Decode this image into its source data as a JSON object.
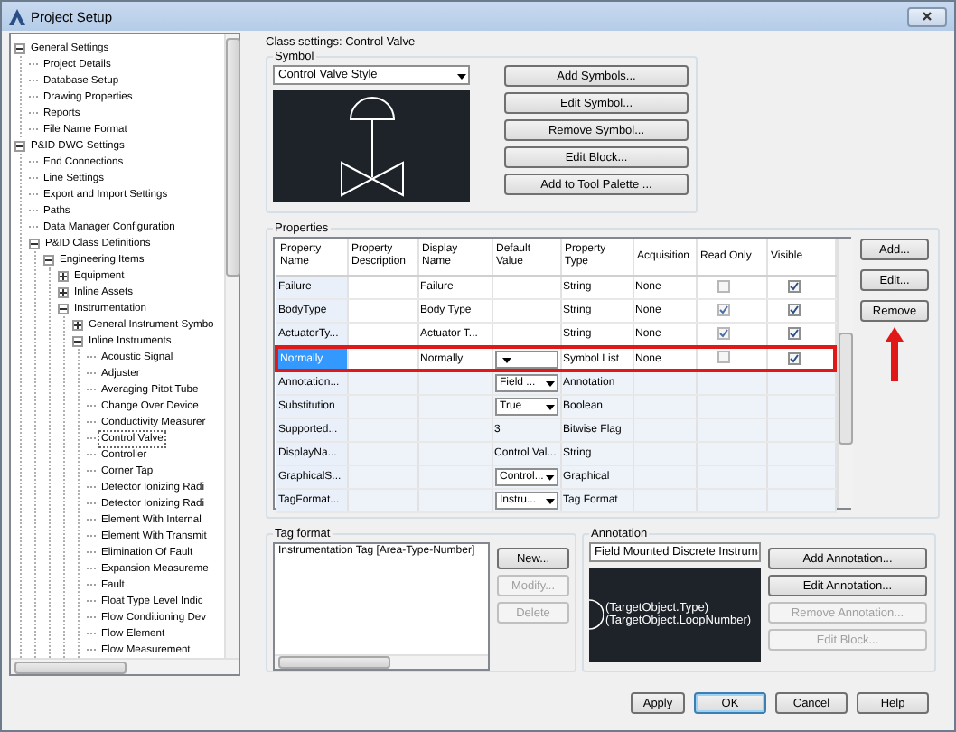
{
  "window": {
    "title": "Project Setup"
  },
  "tree": [
    {
      "label": "General Settings",
      "expanded": true,
      "selected": false,
      "children": [
        {
          "label": "Project Details",
          "selected": false
        },
        {
          "label": "Database Setup",
          "selected": false
        },
        {
          "label": "Drawing Properties",
          "selected": false
        },
        {
          "label": "Reports",
          "selected": false
        },
        {
          "label": "File Name Format",
          "selected": false
        }
      ]
    },
    {
      "label": "P&ID DWG Settings",
      "expanded": true,
      "selected": false,
      "children": [
        {
          "label": "End Connections",
          "selected": false
        },
        {
          "label": "Line Settings",
          "selected": false
        },
        {
          "label": "Export and Import Settings",
          "selected": false
        },
        {
          "label": "Paths",
          "selected": false
        },
        {
          "label": "Data Manager Configuration",
          "selected": false
        },
        {
          "label": "P&ID Class Definitions",
          "expanded": true,
          "selected": false,
          "children": [
            {
              "label": "Engineering Items",
              "expanded": true,
              "selected": false,
              "children": [
                {
                  "label": "Equipment",
                  "expanded": false,
                  "selected": false
                },
                {
                  "label": "Inline Assets",
                  "expanded": false,
                  "selected": false
                },
                {
                  "label": "Instrumentation",
                  "expanded": true,
                  "selected": false,
                  "children": [
                    {
                      "label": "General Instrument Symbo",
                      "expanded": false,
                      "selected": false
                    },
                    {
                      "label": "Inline Instruments",
                      "expanded": true,
                      "selected": false,
                      "children": [
                        {
                          "label": "Acoustic Signal",
                          "selected": false
                        },
                        {
                          "label": "Adjuster",
                          "selected": false
                        },
                        {
                          "label": "Averaging Pitot Tube",
                          "selected": false
                        },
                        {
                          "label": "Change Over Device",
                          "selected": false
                        },
                        {
                          "label": "Conductivity Measurer",
                          "selected": false
                        },
                        {
                          "label": "Control Valve",
                          "selected": true
                        },
                        {
                          "label": "Controller",
                          "selected": false
                        },
                        {
                          "label": "Corner Tap",
                          "selected": false
                        },
                        {
                          "label": "Detector Ionizing Radi",
                          "selected": false
                        },
                        {
                          "label": "Detector Ionizing Radi",
                          "selected": false
                        },
                        {
                          "label": "Element With Internal",
                          "selected": false
                        },
                        {
                          "label": "Element With Transmit",
                          "selected": false
                        },
                        {
                          "label": "Elimination Of Fault",
                          "selected": false
                        },
                        {
                          "label": "Expansion Measureme",
                          "selected": false
                        },
                        {
                          "label": "Fault",
                          "selected": false
                        },
                        {
                          "label": "Float Type Level Indic",
                          "selected": false
                        },
                        {
                          "label": "Flow Conditioning Dev",
                          "selected": false
                        },
                        {
                          "label": "Flow Element",
                          "selected": false
                        },
                        {
                          "label": "Flow Measurement",
                          "selected": false
                        }
                      ]
                    }
                  ]
                }
              ]
            }
          ]
        }
      ]
    }
  ],
  "class_settings": {
    "title": "Class settings: Control Valve"
  },
  "symbol": {
    "legend": "Symbol",
    "style": "Control Valve Style",
    "buttons": [
      {
        "label": "Add Symbols...",
        "disabled": false
      },
      {
        "label": "Edit Symbol...",
        "disabled": false
      },
      {
        "label": "Remove Symbol...",
        "disabled": false
      },
      {
        "label": "Edit Block...",
        "disabled": false
      },
      {
        "label": "Add to Tool Palette ...",
        "disabled": false
      }
    ]
  },
  "properties": {
    "legend": "Properties",
    "columns": [
      "Property Name",
      "Property Description",
      "Display Name",
      "Default Value",
      "Property Type",
      "Acquisition",
      "Read Only",
      "Visible"
    ],
    "rows": [
      {
        "name": "Failure",
        "display": "Failure",
        "dropdown": false,
        "type": "String",
        "acquisition": "None",
        "read_only": false,
        "visible": true,
        "kind": "own",
        "selected": false,
        "highlighted": false
      },
      {
        "name": "BodyType",
        "display": "Body Type",
        "dropdown": false,
        "type": "String",
        "acquisition": "None",
        "read_only": true,
        "visible": true,
        "kind": "own",
        "selected": false,
        "highlighted": false
      },
      {
        "name": "ActuatorTy...",
        "display": "Actuator T...",
        "dropdown": false,
        "type": "String",
        "acquisition": "None",
        "read_only": true,
        "visible": true,
        "kind": "own",
        "selected": false,
        "highlighted": false
      },
      {
        "name": "Normally",
        "display": "Normally",
        "dropdown": true,
        "type": "Symbol List",
        "acquisition": "None",
        "read_only": false,
        "visible": true,
        "kind": "own",
        "selected": true,
        "highlighted": true
      },
      {
        "name": "Annotation...",
        "default_value": "Field ...",
        "dropdown": true,
        "type": "Annotation",
        "kind": "inherited",
        "selected": false,
        "highlighted": false
      },
      {
        "name": "Substitution",
        "default_value": "True",
        "dropdown": true,
        "type": "Boolean",
        "kind": "inherited",
        "selected": false,
        "highlighted": false
      },
      {
        "name": "Supported...",
        "default_value": "3",
        "dropdown": false,
        "type": "Bitwise Flag",
        "kind": "inherited",
        "selected": false,
        "highlighted": false
      },
      {
        "name": "DisplayNa...",
        "default_value": "Control Val...",
        "dropdown": false,
        "type": "String",
        "kind": "inherited",
        "selected": false,
        "highlighted": false
      },
      {
        "name": "GraphicalS...",
        "default_value": "Control...",
        "dropdown": true,
        "type": "Graphical",
        "kind": "inherited",
        "selected": false,
        "highlighted": false
      },
      {
        "name": "TagFormat...",
        "default_value": "Instru...",
        "dropdown": true,
        "type": "Tag Format",
        "kind": "inherited",
        "selected": false,
        "highlighted": false
      }
    ],
    "buttons": [
      {
        "label": "Add...",
        "disabled": false
      },
      {
        "label": "Edit...",
        "disabled": false
      },
      {
        "label": "Remove",
        "disabled": false
      }
    ]
  },
  "tag_format": {
    "legend": "Tag format",
    "items": [
      "Instrumentation Tag [Area-Type-Number]"
    ],
    "buttons": [
      {
        "label": "New...",
        "disabled": false
      },
      {
        "label": "Modify...",
        "disabled": true
      },
      {
        "label": "Delete",
        "disabled": true
      }
    ]
  },
  "annotation": {
    "legend": "Annotation",
    "style": "Field Mounted Discrete Instrum",
    "preview_lines": [
      "(TargetObject.Type)",
      "(TargetObject.LoopNumber)"
    ],
    "buttons": [
      {
        "label": "Add Annotation...",
        "disabled": false
      },
      {
        "label": "Edit Annotation...",
        "disabled": false
      },
      {
        "label": "Remove Annotation...",
        "disabled": true
      },
      {
        "label": "Edit Block...",
        "disabled": true
      }
    ]
  },
  "footer_buttons": [
    {
      "label": "Apply",
      "default": false
    },
    {
      "label": "OK",
      "default": true
    },
    {
      "label": "Cancel",
      "default": false
    },
    {
      "label": "Help",
      "default": false
    }
  ]
}
